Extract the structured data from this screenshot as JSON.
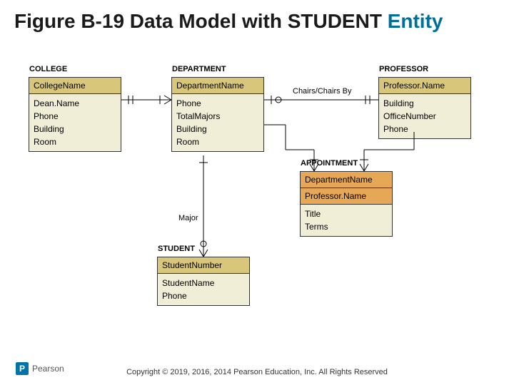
{
  "title_prefix": "Figure B-19 Data Model with STUDENT ",
  "title_accent": "Entity",
  "entities": {
    "college": {
      "name": "COLLEGE",
      "pk": "CollegeName",
      "attrs": "Dean.Name\nPhone\nBuilding\nRoom"
    },
    "department": {
      "name": "DEPARTMENT",
      "pk": "DepartmentName",
      "attrs": "Phone\nTotalMajors\nBuilding\nRoom"
    },
    "professor": {
      "name": "PROFESSOR",
      "pk": "Professor.Name",
      "attrs": "Building\nOfficeNumber\nPhone"
    },
    "appointment": {
      "name": "APPOINTMENT",
      "pk1": "DepartmentName",
      "pk2": "Professor.Name",
      "attrs": "Title\nTerms"
    },
    "student": {
      "name": "STUDENT",
      "pk": "StudentNumber",
      "attrs": "StudentName\nPhone"
    }
  },
  "rel_chairs": "Chairs/Chairs By",
  "rel_major": "Major",
  "copyright": "Copyright © 2019, 2016, 2014 Pearson Education, Inc. All Rights Reserved",
  "brand": "Pearson",
  "brand_letter": "P"
}
